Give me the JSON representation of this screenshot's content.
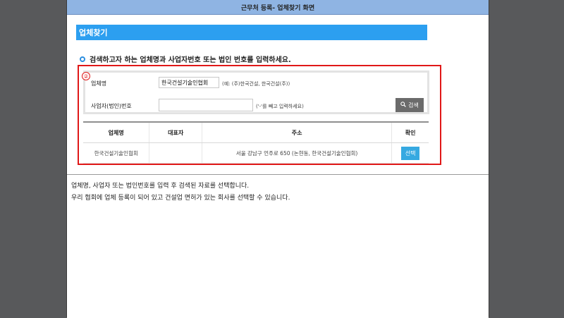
{
  "window": {
    "title": "근무처 등록- 업체찾기 화면"
  },
  "section": {
    "title": "업체찾기"
  },
  "instruction": "검색하고자 하는 업체명과 사업자번호 또는 법인 번호를 입력하세요.",
  "marker": "②",
  "form": {
    "company_label": "업체명",
    "company_value": "한국건설기술인협회",
    "company_hint": "(예: (주)한국건설, 한국건설(주))",
    "bizno_label": "사업자(법인)번호",
    "bizno_value": "",
    "bizno_hint": "('-'를 빼고 입력하세요)",
    "search_label": "검색",
    "search_icon": "magnifier-icon"
  },
  "table": {
    "headers": [
      "업체명",
      "대표자",
      "주소",
      "확인"
    ],
    "rows": [
      {
        "company": "한국건설기술인협회",
        "representative": "",
        "address": "서울 강남구 언주로 650 (논현동, 한국건설기술인협회)",
        "action": "선택"
      }
    ]
  },
  "footer": {
    "line1": "업체명, 사업자 또는 법인번호를 입력 후 검색된 자료를 선택합니다.",
    "line2": "우리 협회에 업체 등록이 되어 있고 건설업 면허가 있는 회사를 선택할 수 있습니다."
  },
  "colors": {
    "accent": "#2c9ff0",
    "titlebar": "#8fb4e3",
    "highlight_box": "#e01818",
    "select_button": "#36a9e1"
  }
}
